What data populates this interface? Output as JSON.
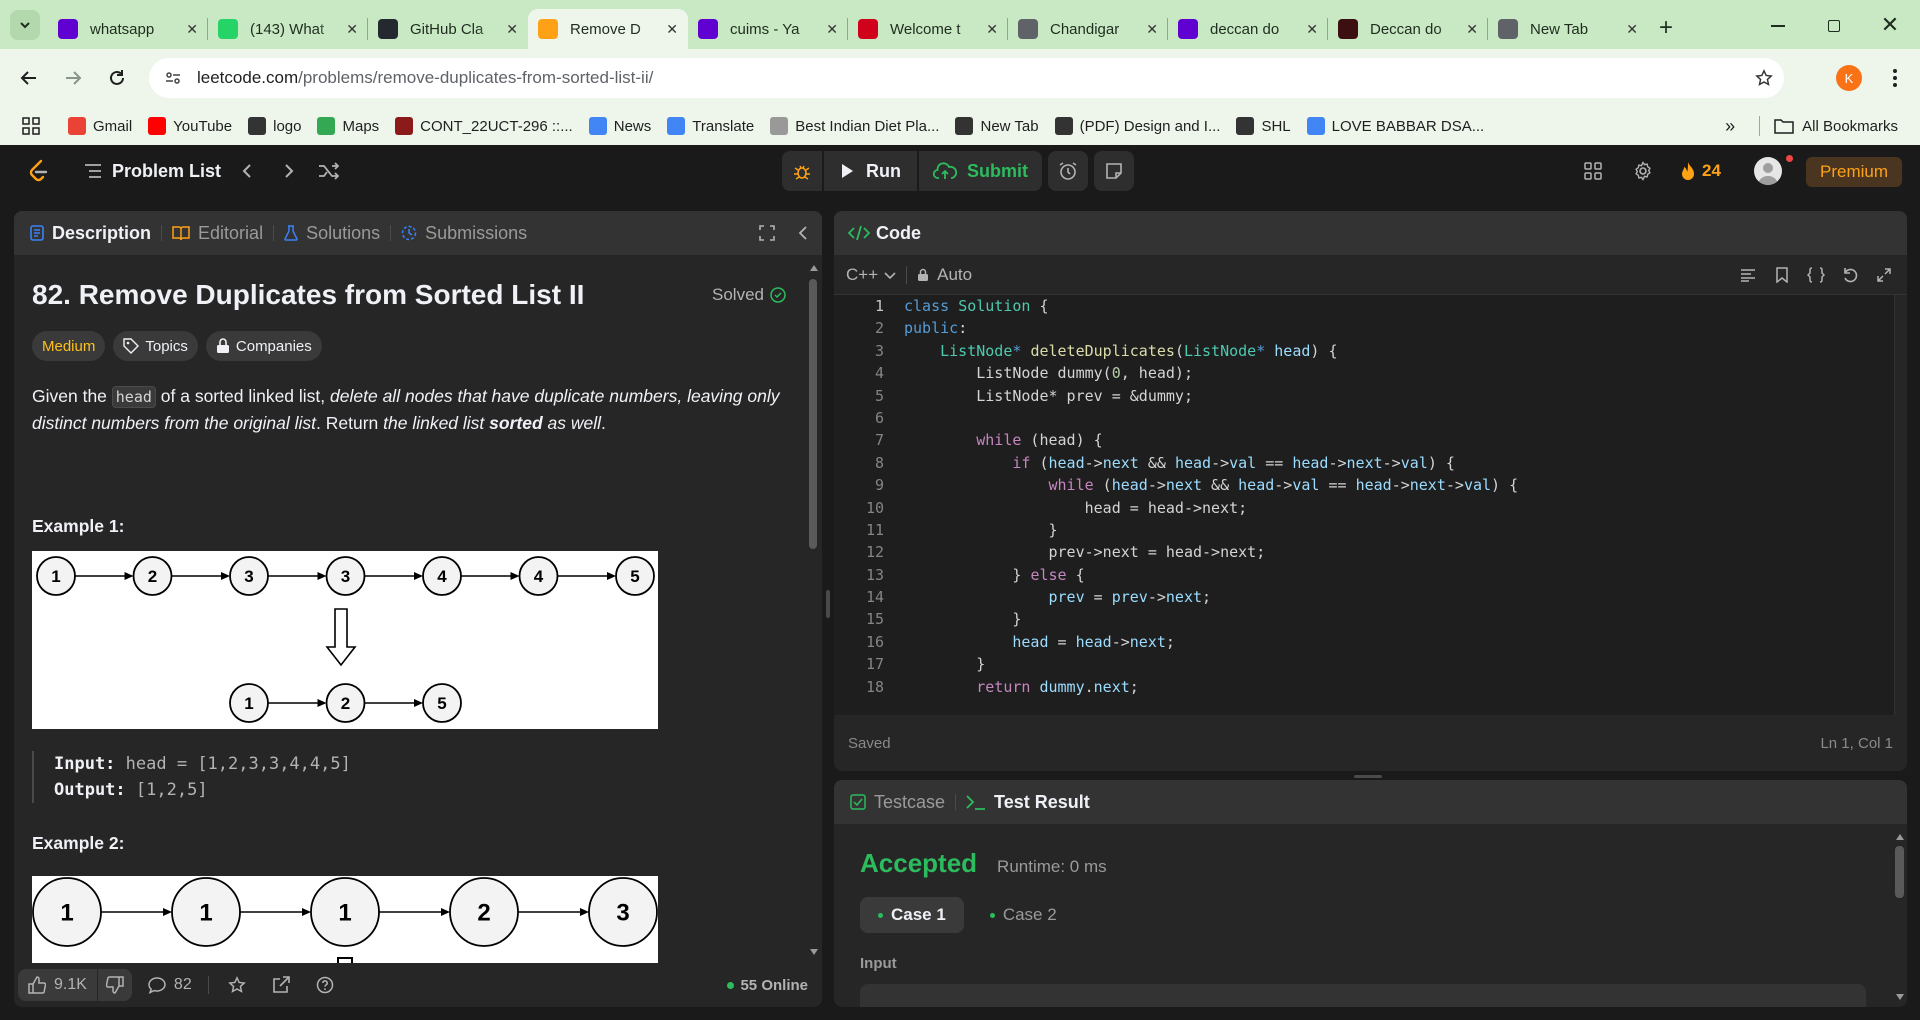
{
  "browser": {
    "tabs": [
      {
        "title": "whatsapp",
        "favicon": "yahoo-icon",
        "color": "#6001d2"
      },
      {
        "title": "(143) What",
        "favicon": "whatsapp-icon",
        "color": "#25d366"
      },
      {
        "title": "GitHub Cla",
        "favicon": "github-icon",
        "color": "#24292f"
      },
      {
        "title": "Remove D",
        "favicon": "leetcode-icon",
        "color": "#ffa116"
      },
      {
        "title": "cuims - Ya",
        "favicon": "yahoo-icon",
        "color": "#6001d2"
      },
      {
        "title": "Welcome t",
        "favicon": "cuims-icon",
        "color": "#d0021b"
      },
      {
        "title": "Chandigar",
        "favicon": "globe-icon",
        "color": "#5f6368"
      },
      {
        "title": "deccan do",
        "favicon": "yahoo-icon",
        "color": "#6001d2"
      },
      {
        "title": "Deccan do",
        "favicon": "dg-icon",
        "color": "#3c1010"
      },
      {
        "title": "New Tab",
        "favicon": "globe-icon",
        "color": "#5f6368"
      }
    ],
    "active_tab": 3,
    "url_domain": "leetcode.com",
    "url_path": "/problems/remove-duplicates-from-sorted-list-ii/",
    "profile_initial": "K",
    "bookmarks": [
      {
        "label": "Gmail",
        "icon": "gmail-icon",
        "color": "#ea4335"
      },
      {
        "label": "YouTube",
        "icon": "youtube-icon",
        "color": "#ff0000"
      },
      {
        "label": "logo",
        "icon": "globe-icon",
        "color": "#333333"
      },
      {
        "label": "Maps",
        "icon": "maps-icon",
        "color": "#34a853"
      },
      {
        "label": "CONT_22UCT-296 ::...",
        "icon": "cuims-icon",
        "color": "#8b1a1a"
      },
      {
        "label": "News",
        "icon": "news-icon",
        "color": "#4285f4"
      },
      {
        "label": "Translate",
        "icon": "translate-icon",
        "color": "#4285f4"
      },
      {
        "label": "Best Indian Diet Pla...",
        "icon": "page-icon",
        "color": "#999999"
      },
      {
        "label": "New Tab",
        "icon": "history-icon",
        "color": "#333333"
      },
      {
        "label": "(PDF) Design and I...",
        "icon": "researchgate-icon",
        "color": "#333333"
      },
      {
        "label": "SHL",
        "icon": "shl-icon",
        "color": "#333333"
      },
      {
        "label": "LOVE BABBAR DSA...",
        "icon": "google-icon",
        "color": "#4285f4"
      }
    ],
    "all_bookmarks": "All Bookmarks"
  },
  "nav": {
    "problem_list": "Problem List",
    "run": "Run",
    "submit": "Submit",
    "streak": "24",
    "premium": "Premium"
  },
  "left": {
    "tabs": [
      "Description",
      "Editorial",
      "Solutions",
      "Submissions"
    ],
    "title": "82. Remove Duplicates from Sorted List II",
    "solved": "Solved",
    "difficulty": "Medium",
    "topics": "Topics",
    "companies": "Companies",
    "desc": {
      "p1": "Given the ",
      "code": "head",
      "p2": " of a sorted linked list, ",
      "em1": "delete all nodes that have duplicate numbers, leaving only distinct numbers from the original list",
      "p3": ". Return ",
      "em2": "the linked list ",
      "strong": "sorted",
      "em3": " as well",
      "p4": "."
    },
    "example1_title": "Example 1:",
    "example1_list": [
      "1",
      "2",
      "3",
      "3",
      "4",
      "4",
      "5"
    ],
    "example1_result": [
      "1",
      "2",
      "5"
    ],
    "input_label": "Input:",
    "input_value": "head = [1,2,3,3,4,4,5]",
    "output_label": "Output:",
    "output_value": "[1,2,5]",
    "example2_title": "Example 2:",
    "example2_list": [
      "1",
      "1",
      "1",
      "2",
      "3"
    ],
    "likes": "9.1K",
    "comments": "82",
    "online": "55 Online"
  },
  "code": {
    "header": "Code",
    "language": "C++",
    "auto": "Auto",
    "saved": "Saved",
    "cursor": "Ln 1, Col 1",
    "line_numbers": [
      "1",
      "2",
      "3",
      "4",
      "5",
      "6",
      "7",
      "8",
      "9",
      "10",
      "11",
      "12",
      "13",
      "14",
      "15",
      "16",
      "17",
      "18"
    ]
  },
  "result": {
    "testcase": "Testcase",
    "test_result": "Test Result",
    "status": "Accepted",
    "runtime": "Runtime: 0 ms",
    "case1": "Case 1",
    "case2": "Case 2",
    "input_label": "Input"
  },
  "colors": {
    "accent_orange": "#ffa116",
    "easy_green": "#2cbb5d",
    "medium_yellow": "#ffc01e"
  }
}
